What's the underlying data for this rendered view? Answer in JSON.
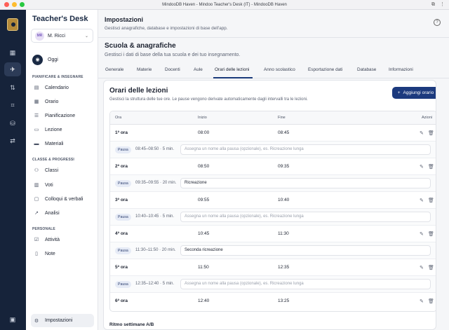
{
  "window": {
    "title": "MindooDB Haven - Mindoo Teacher's Desk (IT) - MindooDB Haven"
  },
  "brand": "Teacher's Desk",
  "user": {
    "initials": "MR",
    "name": "M. Ricci"
  },
  "sidebar": {
    "oggi": "Oggi",
    "sections": [
      {
        "label": "PIANIFICARE & INSEGNARE",
        "items": [
          "Calendario",
          "Orario",
          "Pianificazione",
          "Lezione",
          "Materiali"
        ]
      },
      {
        "label": "CLASSE & PROGRESSI",
        "items": [
          "Classi",
          "Voti",
          "Colloqui & verbali",
          "Analisi"
        ]
      },
      {
        "label": "PERSONALE",
        "items": [
          "Attività",
          "Note"
        ]
      }
    ],
    "footer": "Impostazioni"
  },
  "header": {
    "title": "Impostazioni",
    "subtitle": "Gestisci anagrafiche, database e impostazioni di base dell'app."
  },
  "section": {
    "title": "Scuola & anagrafiche",
    "subtitle": "Gestisci i dati di base della tua scuola e dei tuo insegnamento."
  },
  "tabs": [
    "Generale",
    "Materie",
    "Docenti",
    "Aule",
    "Orari delle lezioni",
    "Anno scolastico",
    "Esportazione dati",
    "Database",
    "Informazioni"
  ],
  "active_tab": "Orari delle lezioni",
  "card": {
    "title": "Orari delle lezioni",
    "subtitle": "Gestisci la struttura delle tue ore. Le pause vengono derivate automaticamente dagli intervalli tra le lezioni.",
    "add_button": "Aggiungi orario",
    "columns": {
      "ora": "Ora",
      "inizio": "Inizio",
      "fine": "Fine",
      "azioni": "Azioni"
    },
    "pause_label": "Pausa",
    "pause_placeholder": "Assegna un nome alla pausa (opzionale), es. Ricreazione lunga",
    "lessons": [
      {
        "ora": "1ª ora",
        "inizio": "08:00",
        "fine": "08:45"
      },
      {
        "ora": "2ª ora",
        "inizio": "08:50",
        "fine": "09:35"
      },
      {
        "ora": "3ª ora",
        "inizio": "09:55",
        "fine": "10:40"
      },
      {
        "ora": "4ª ora",
        "inizio": "10:45",
        "fine": "11:30"
      },
      {
        "ora": "5ª ora",
        "inizio": "11:50",
        "fine": "12:35"
      },
      {
        "ora": "6ª ora",
        "inizio": "12:40",
        "fine": "13:25"
      }
    ],
    "pauses": [
      {
        "time": "08:45–08:50 · 5 min.",
        "name": ""
      },
      {
        "time": "09:35–09:55 · 20 min.",
        "name": "Ricreazione"
      },
      {
        "time": "10:40–10:45 · 5 min.",
        "name": ""
      },
      {
        "time": "11:30–11:50 · 20 min.",
        "name": "Seconda ricreazione"
      },
      {
        "time": "12:35–12:40 · 5 min.",
        "name": ""
      }
    ],
    "ritmo": "Ritmo settimane A/B"
  }
}
